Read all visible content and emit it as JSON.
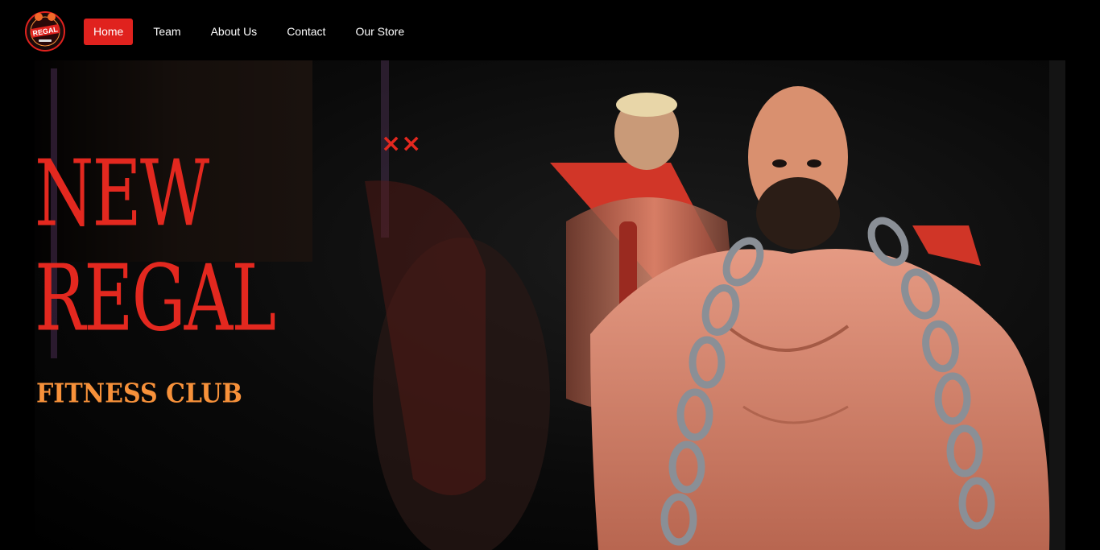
{
  "brand": {
    "logo_text": "REGAL",
    "logo_subtext": "FITNESS CLUB",
    "colors": {
      "accent": "#e0221e",
      "title": "#e3281f",
      "subtitle": "#f7913a"
    }
  },
  "nav": {
    "items": [
      {
        "label": "Home",
        "active": true
      },
      {
        "label": "Team",
        "active": false
      },
      {
        "label": "About Us",
        "active": false
      },
      {
        "label": "Contact",
        "active": false
      },
      {
        "label": "Our Store",
        "active": false
      }
    ]
  },
  "hero": {
    "title_line1": "NEW",
    "title_line2": "REGAL",
    "subtitle": "FITNESS CLUB",
    "decoration": "××",
    "image": "muscular man with chain over shoulders in dark gym, red geometric shapes behind"
  }
}
